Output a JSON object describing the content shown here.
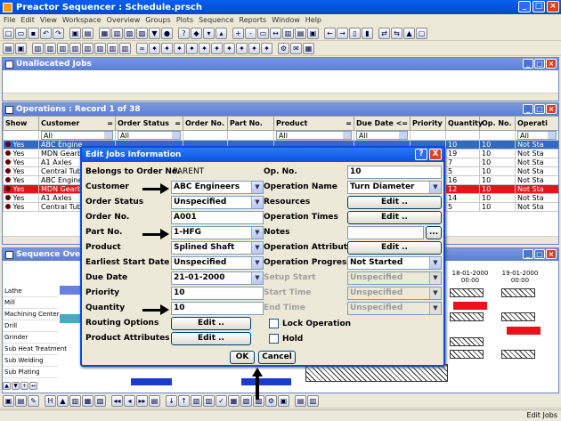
{
  "app": {
    "title": "Preactor Sequencer : Schedule.prsch",
    "status_text": "Edit Jobs"
  },
  "menu": [
    "File",
    "Edit",
    "View",
    "Workspace",
    "Overview",
    "Groups",
    "Plots",
    "Sequence",
    "Reports",
    "Window",
    "Help"
  ],
  "unallocated": {
    "title": "Unallocated Jobs"
  },
  "operations": {
    "title": "Operations : Record 1 of 38",
    "columns": [
      "Show",
      "Customer",
      "Order Status",
      "Order No.",
      "Part No.",
      "Product",
      "Due Date",
      "Priority",
      "Quantity",
      "Op. No.",
      "Operati"
    ],
    "column_ops": [
      "",
      "=",
      "=",
      "",
      "",
      "=",
      "<=",
      "",
      "",
      "",
      ""
    ],
    "filters": [
      "",
      "All",
      "All",
      "",
      "",
      "All",
      "All",
      "",
      "",
      "",
      "All"
    ],
    "rows": [
      {
        "show": "Yes",
        "customer": "ABC Engine",
        "qty": "10",
        "op": "10",
        "status": "Not Sta",
        "style": "sel"
      },
      {
        "show": "Yes",
        "customer": "MDN Gearb",
        "qty": "19",
        "op": "10",
        "status": "Not Sta",
        "style": ""
      },
      {
        "show": "Yes",
        "customer": "A1 Axles",
        "qty": "7",
        "op": "10",
        "status": "Not Sta",
        "style": ""
      },
      {
        "show": "Yes",
        "customer": "Central Tub",
        "qty": "5",
        "op": "10",
        "status": "Not Sta",
        "style": ""
      },
      {
        "show": "Yes",
        "customer": "ABC Engine",
        "qty": "16",
        "op": "10",
        "status": "Not Sta",
        "style": ""
      },
      {
        "show": "Yes",
        "customer": "MDN Gearb",
        "qty": "12",
        "op": "10",
        "status": "Not Sta",
        "style": "red"
      },
      {
        "show": "Yes",
        "customer": "A1 Axles",
        "qty": "14",
        "op": "10",
        "status": "Not Sta",
        "style": ""
      },
      {
        "show": "Yes",
        "customer": "Central Tub",
        "qty": "5",
        "op": "10",
        "status": "Not Sta",
        "style": ""
      }
    ]
  },
  "sequence": {
    "title": "Sequence Overview",
    "date1": "18-01-2000",
    "time1": "00:00",
    "date2": "19-01-2000",
    "time2": "00:00",
    "resources": [
      "Lathe",
      "Mill",
      "Machining Center",
      "Drill",
      "Grinder",
      "Sub Heat Treatment",
      "Sub Welding",
      "Sub Plating"
    ]
  },
  "dialog": {
    "title": "Edit Jobs Information",
    "left": [
      {
        "label": "Belongs to Order No.",
        "value": "PARENT",
        "kind": "text-plain"
      },
      {
        "label": "Customer",
        "value": "ABC Engineers",
        "kind": "combo"
      },
      {
        "label": "Order Status",
        "value": "Unspecified",
        "kind": "combo"
      },
      {
        "label": "Order No.",
        "value": "A001",
        "kind": "text"
      },
      {
        "label": "Part No.",
        "value": "1-HFG",
        "kind": "combo"
      },
      {
        "label": "Product",
        "value": "Splined Shaft",
        "kind": "combo"
      },
      {
        "label": "Earliest Start Date",
        "value": "Unspecified",
        "kind": "combo"
      },
      {
        "label": "Due Date",
        "value": "21-01-2000",
        "kind": "combo"
      },
      {
        "label": "Priority",
        "value": "10",
        "kind": "text"
      },
      {
        "label": "Quantity",
        "value": "10",
        "kind": "text"
      },
      {
        "label": "Routing Options",
        "value": "Edit ..",
        "kind": "button"
      },
      {
        "label": "Product Attributes",
        "value": "Edit ..",
        "kind": "button"
      }
    ],
    "right": [
      {
        "label": "Op. No.",
        "value": "10",
        "kind": "text"
      },
      {
        "label": "Operation Name",
        "value": "Turn Diameter",
        "kind": "combo"
      },
      {
        "label": "Resources",
        "value": "Edit ..",
        "kind": "button"
      },
      {
        "label": "Operation Times",
        "value": "Edit ..",
        "kind": "button"
      },
      {
        "label": "Notes",
        "value": "",
        "kind": "notes",
        "extra": "..."
      },
      {
        "label": "Operation Attributes",
        "value": "Edit ..",
        "kind": "button"
      },
      {
        "label": "Operation Progress",
        "value": "Not Started",
        "kind": "combo"
      },
      {
        "label": "Setup Start",
        "value": "Unspecified",
        "kind": "combo-dis"
      },
      {
        "label": "Start Time",
        "value": "Unspecified",
        "kind": "combo-dis"
      },
      {
        "label": "End Time",
        "value": "Unspecified",
        "kind": "combo-dis"
      }
    ],
    "checks": [
      "Lock Operation",
      "Hold"
    ],
    "ok": "OK",
    "cancel": "Cancel",
    "help": "?",
    "close": "X"
  }
}
